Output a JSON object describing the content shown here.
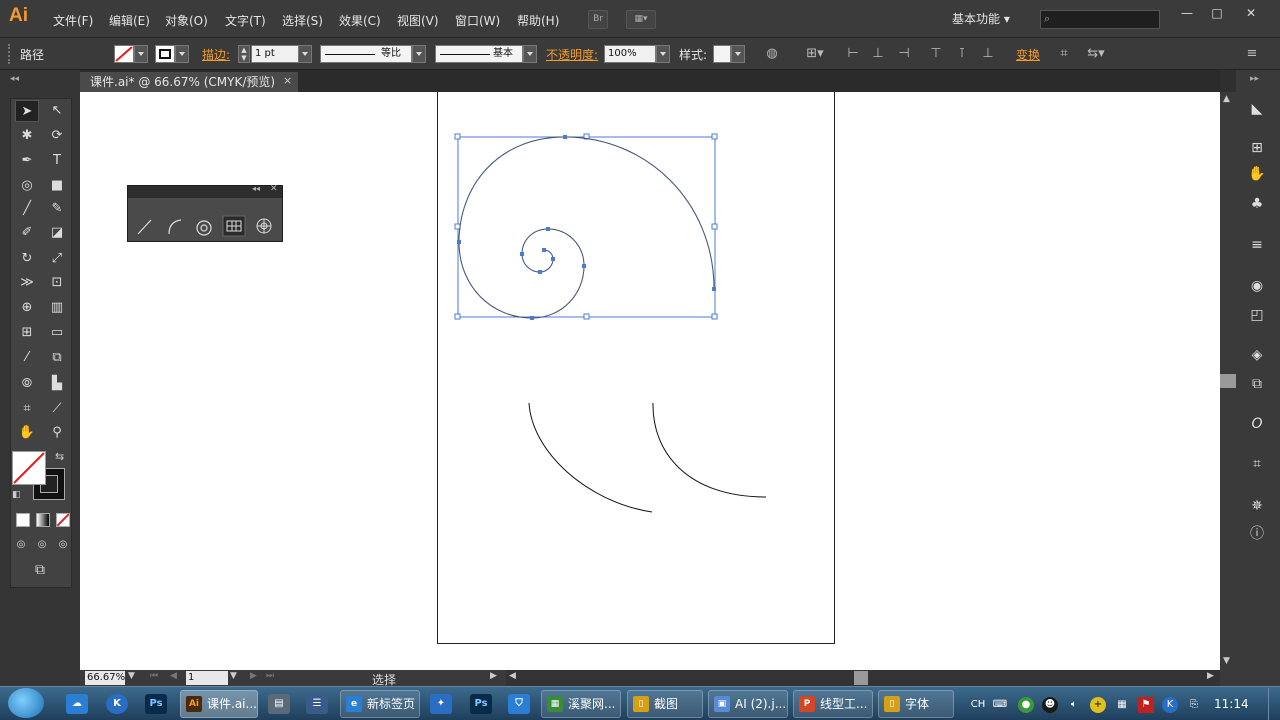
{
  "app": {
    "logo": "Ai",
    "menu": [
      "文件(F)",
      "编辑(E)",
      "对象(O)",
      "文字(T)",
      "选择(S)",
      "效果(C)",
      "视图(V)",
      "窗口(W)",
      "帮助(H)"
    ],
    "bridge_label": "Br",
    "workspace": "基本功能",
    "search_placeholder": ""
  },
  "window_controls": {
    "minimize": "—",
    "restore": "□",
    "close": "✕"
  },
  "control_bar": {
    "object_type": "路径",
    "stroke_label": "描边:",
    "stroke_weight": "1 pt",
    "profile_label": "等比",
    "brush_label": "基本",
    "opacity_label": "不透明度:",
    "opacity_value": "100%",
    "style_label": "样式:",
    "transform_label": "变换"
  },
  "document_tab": {
    "title": "课件.ai* @ 66.67% (CMYK/预览)",
    "close": "×"
  },
  "status_bar": {
    "zoom": "66.67%",
    "page": "1",
    "status": "选择"
  },
  "taskbar": {
    "tasks": [
      {
        "label": "课件.ai...",
        "icon": "Ai",
        "color": "#4a2a0a"
      },
      {
        "label": "新标签页",
        "icon": "e",
        "color": "#2a7fd4"
      },
      {
        "label": "溪聚网...",
        "icon": "▦",
        "color": "#3a8a3a"
      },
      {
        "label": "截图",
        "icon": "▯",
        "color": "#d4a017"
      },
      {
        "label": "AI (2).j...",
        "icon": "▣",
        "color": "#5a8ad4"
      },
      {
        "label": "线型工...",
        "icon": "P",
        "color": "#d24726"
      },
      {
        "label": "字体",
        "icon": "▯",
        "color": "#d4a017"
      }
    ],
    "lang": "CH",
    "time": "11:14"
  },
  "colors": {
    "accent": "#f39c2b",
    "selection": "#4a7bd4"
  }
}
